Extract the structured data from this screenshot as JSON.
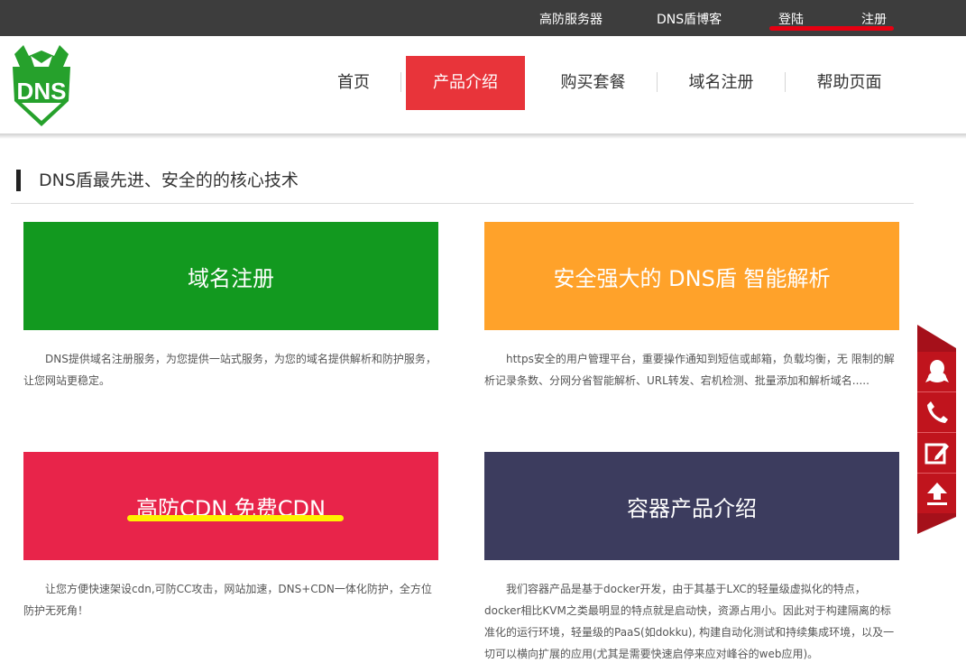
{
  "topbar": {
    "links": [
      "高防服务器",
      "DNS盾博客",
      "登陆",
      "注册"
    ]
  },
  "logo": {
    "text": "DNS",
    "color": "#26a12c"
  },
  "nav": {
    "items": [
      "首页",
      "产品介绍",
      "购买套餐",
      "域名注册",
      "帮助页面"
    ],
    "active_index": 1
  },
  "section": {
    "title": "DNS盾最先进、安全的的核心技术"
  },
  "cards": [
    {
      "title": "域名注册",
      "color": "#12991f",
      "desc": "DNS提供域名注册服务，为您提供一站式服务，为您的域名提供解析和防护服务，让您网站更稳定。"
    },
    {
      "title": "安全强大的 DNS盾 智能解析",
      "color": "#ffa22a",
      "desc": "https安全的用户管理平台，重要操作通知到短信或邮箱，负载均衡，无 限制的解析记录条数、分网分省智能解析、URL转发、宕机检测、批量添加和解析域名....."
    },
    {
      "title": "高防CDN,免费CDN",
      "color": "#e8244a",
      "desc": "让您方便快速架设cdn,可防CC攻击，网站加速，DNS+CDN一体化防护，全方位防护无死角！"
    },
    {
      "title": "容器产品介绍",
      "color": "#3c3c5e",
      "desc": "我们容器产品是基于docker开发，由于其基于LXC的轻量级虚拟化的特点，docker相比KVM之类最明显的特点就是启动快，资源占用小。因此对于构建隔离的标准化的运行环境，轻量级的PaaS(如dokku), 构建自动化测试和持续集成环境，以及一切可以横向扩展的应用(尤其是需要快速启停来应对峰谷的web应用)。"
    }
  ],
  "side_tools": {
    "icons": [
      "qq-icon",
      "phone-icon",
      "edit-icon",
      "back-to-top-icon"
    ],
    "color": "#c0141d"
  }
}
